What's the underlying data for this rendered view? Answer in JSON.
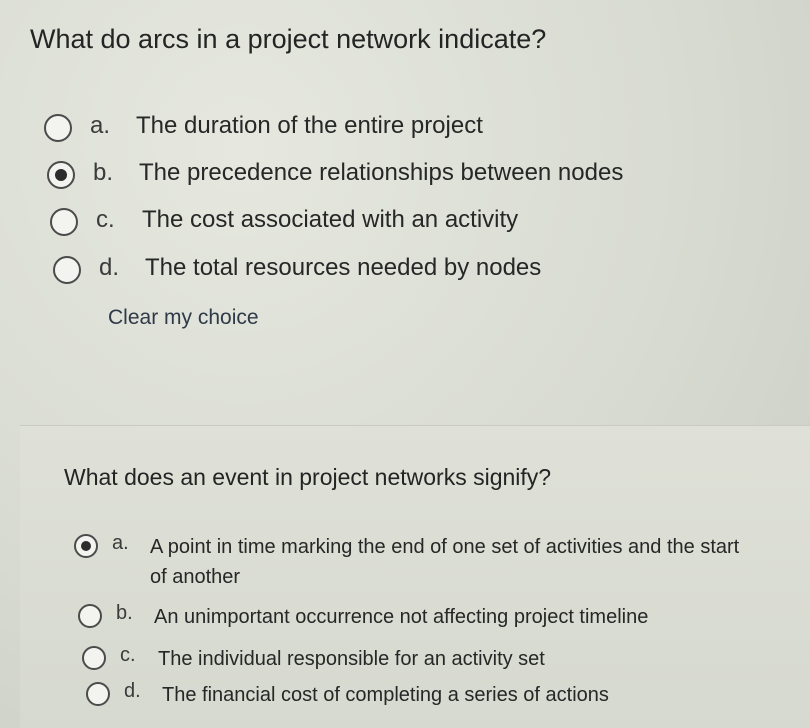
{
  "question1": {
    "text": "What do arcs in a project network indicate?",
    "selected": "b",
    "options": [
      {
        "letter": "a.",
        "text": "The duration of the entire project"
      },
      {
        "letter": "b.",
        "text": "The precedence relationships between nodes"
      },
      {
        "letter": "c.",
        "text": "The cost associated with an activity"
      },
      {
        "letter": "d.",
        "text": "The total resources needed by nodes"
      }
    ],
    "clear_label": "Clear my choice"
  },
  "question2": {
    "text": "What does an event in project networks signify?",
    "selected": "a",
    "options": [
      {
        "letter": "a.",
        "text": "A point in time marking the end of one set of activities and the start of another"
      },
      {
        "letter": "b.",
        "text": "An unimportant occurrence not affecting project timeline"
      },
      {
        "letter": "c.",
        "text": "The individual responsible for an activity set"
      },
      {
        "letter": "d.",
        "text": "The financial cost of completing a series of actions"
      }
    ]
  }
}
